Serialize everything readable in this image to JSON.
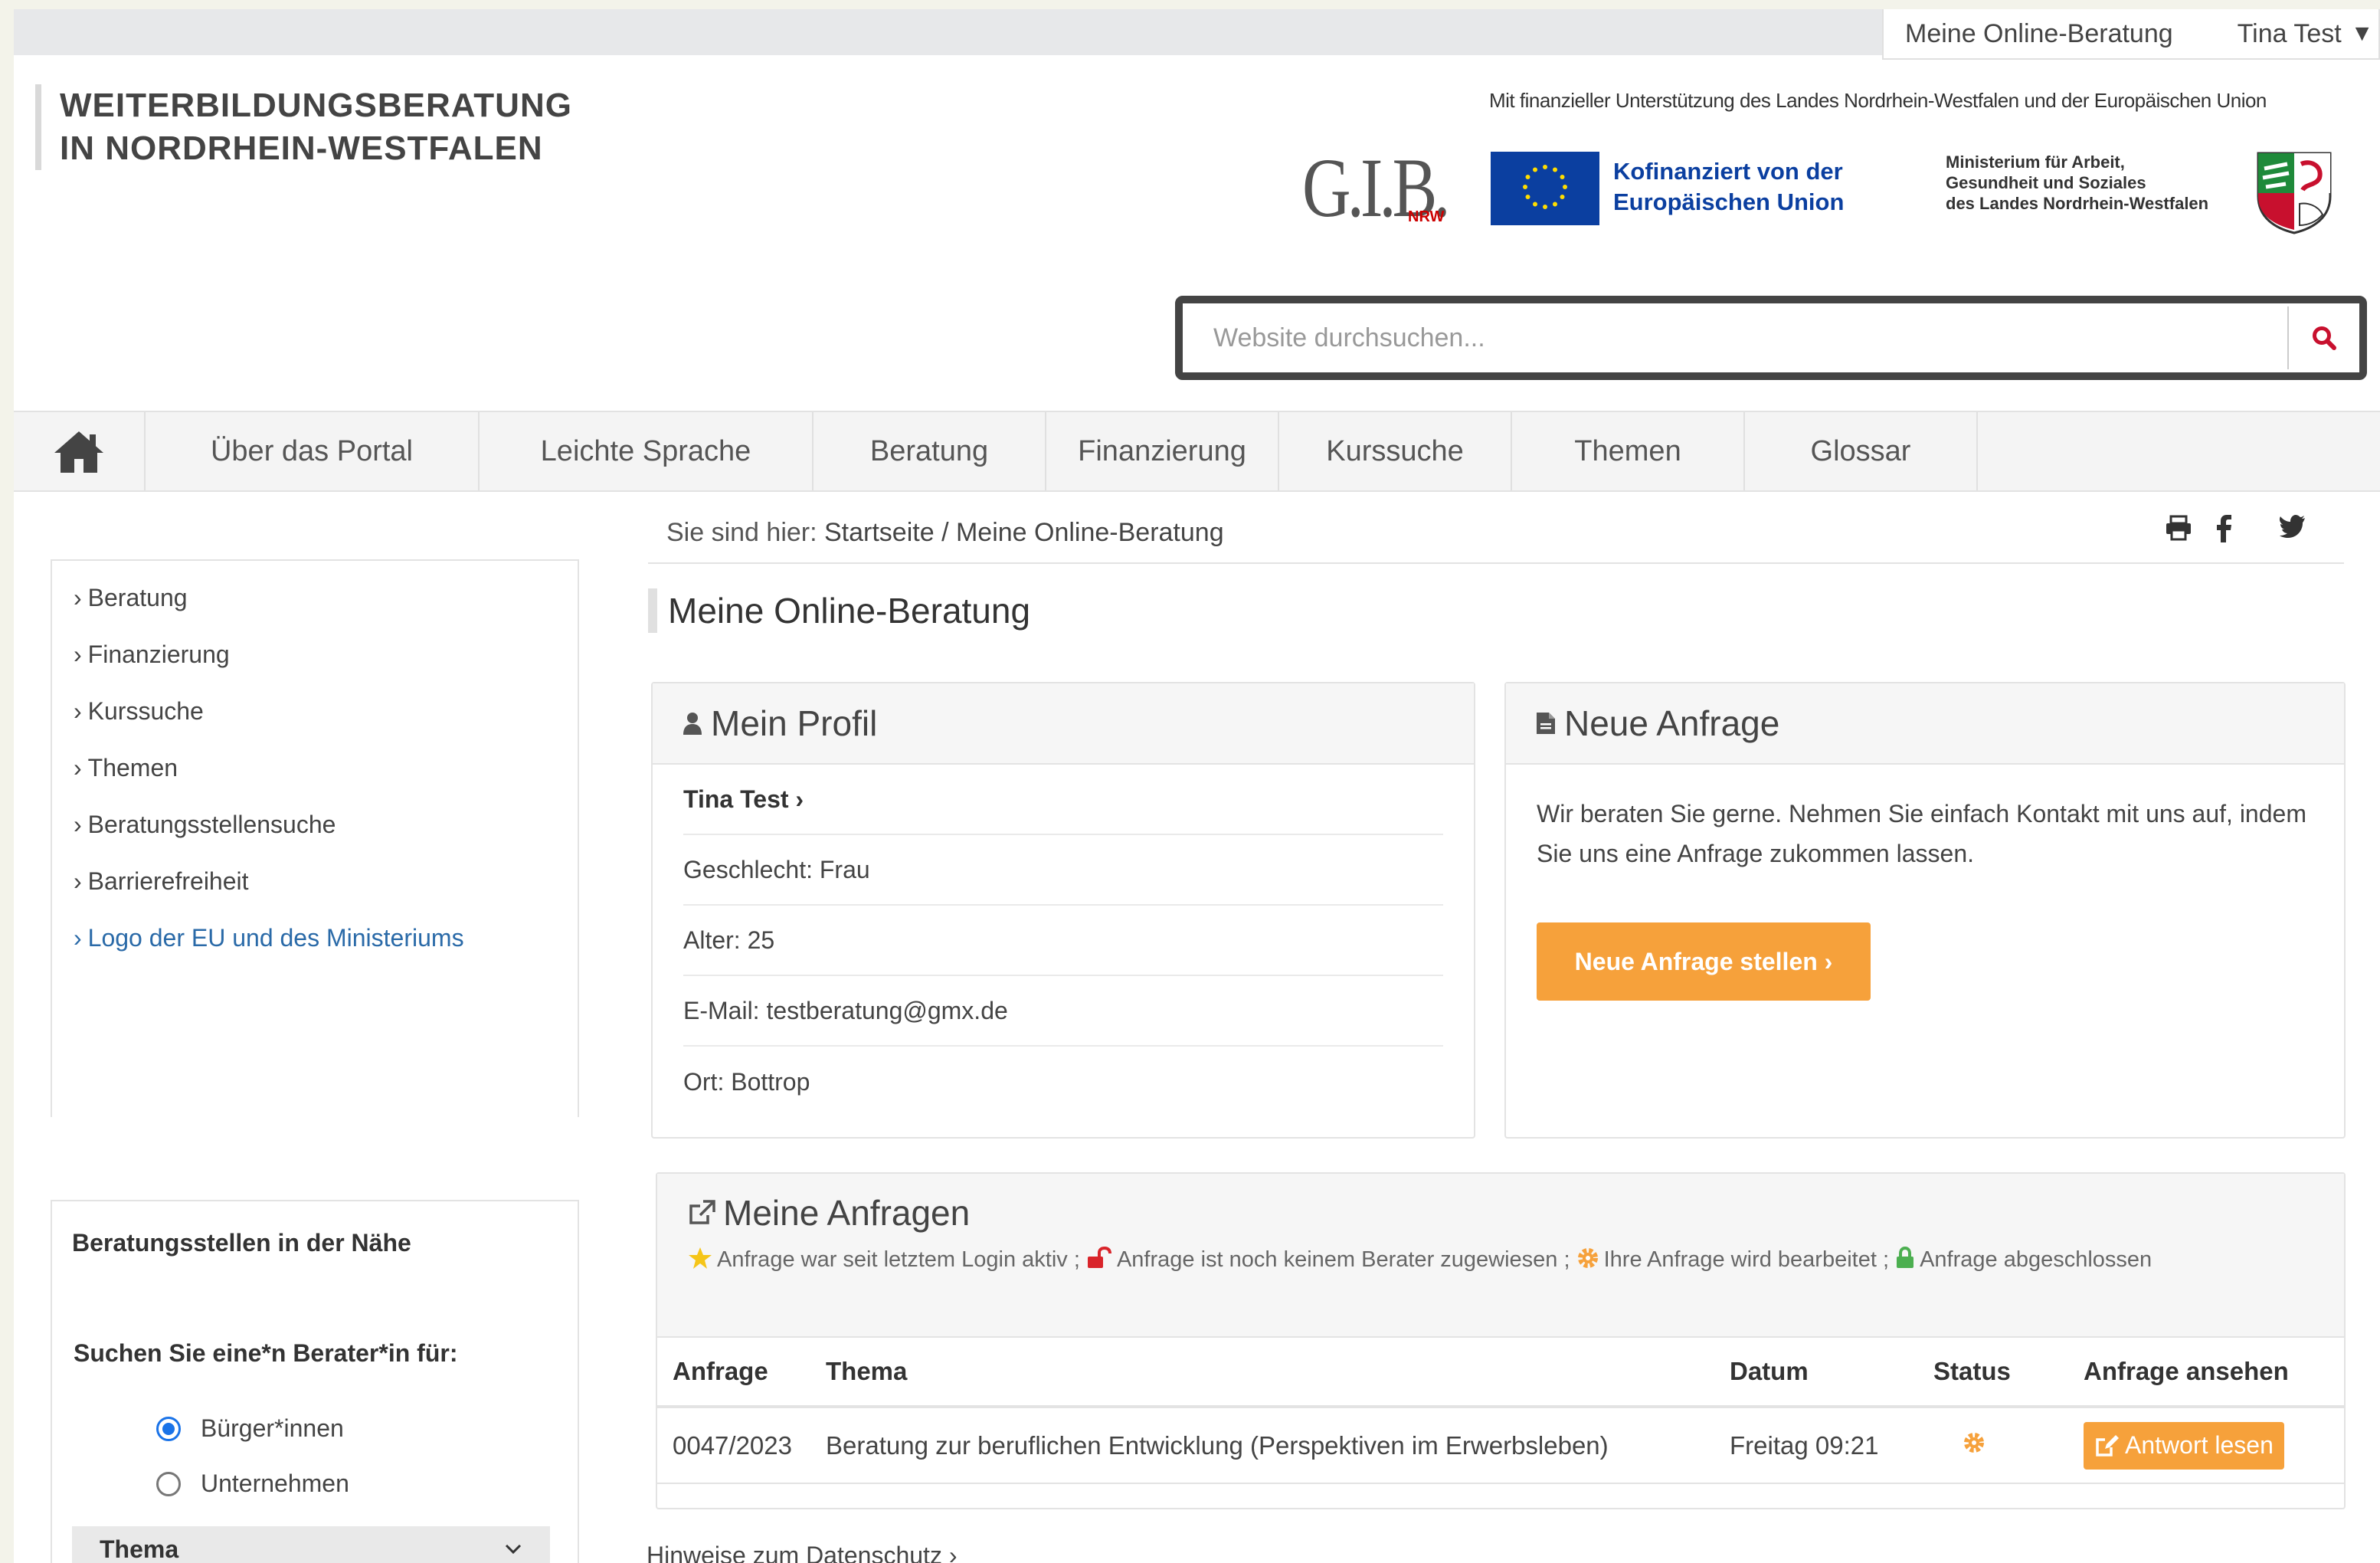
{
  "topbar": {
    "online_label": "Meine Online-Beratung",
    "user_label": "Tina Test",
    "caret": "▼"
  },
  "brand": {
    "line1": "WEITERBILDUNGSBERATUNG",
    "line2": "IN NORDRHEIN-WESTFALEN"
  },
  "sponsors": {
    "support_text": "Mit finanzieller Unterstützung des Landes Nordrhein-Westfalen und der Europäischen Union",
    "gib_logo": "G.I.B.",
    "gib_suffix": "NRW",
    "eu_line1": "Kofinanziert von der",
    "eu_line2": "Europäischen Union",
    "ministry_line1": "Ministerium für Arbeit,",
    "ministry_line2": "Gesundheit und Soziales",
    "ministry_line3": "des Landes Nordrhein-Westfalen"
  },
  "search": {
    "placeholder": "Website durchsuchen..."
  },
  "nav": {
    "items": [
      {
        "label": "Über das Portal"
      },
      {
        "label": "Leichte Sprache"
      },
      {
        "label": "Beratung"
      },
      {
        "label": "Finanzierung"
      },
      {
        "label": "Kurssuche"
      },
      {
        "label": "Themen"
      },
      {
        "label": "Glossar"
      }
    ]
  },
  "breadcrumb": {
    "prefix": "Sie sind hier:",
    "path": "Startseite / Meine Online-Beratung"
  },
  "sidebar": {
    "links": [
      {
        "label": "Beratung"
      },
      {
        "label": "Finanzierung"
      },
      {
        "label": "Kurssuche"
      },
      {
        "label": "Themen"
      },
      {
        "label": "Beratungsstellensuche"
      },
      {
        "label": "Barrierefreiheit"
      },
      {
        "label": "Logo der EU und des Ministeriums"
      }
    ],
    "nearby": {
      "title": "Beratungsstellen in der Nähe",
      "subtitle": "Suchen Sie eine*n Berater*in für:",
      "options": [
        {
          "label": "Bürger*innen",
          "selected": true
        },
        {
          "label": "Unternehmen",
          "selected": false
        }
      ],
      "select_label": "Thema"
    }
  },
  "page": {
    "title": "Meine Online-Beratung"
  },
  "profile": {
    "title": "Mein Profil",
    "name": "Tina Test ›",
    "gender": "Geschlecht: Frau",
    "age": "Alter: 25",
    "email": "E-Mail: testberatung@gmx.de",
    "city": "Ort: Bottrop"
  },
  "new_request": {
    "title": "Neue Anfrage",
    "text": "Wir beraten Sie gerne. Nehmen Sie einfach Kontakt mit uns auf, indem Sie uns eine Anfrage zukommen lassen.",
    "button": "Neue Anfrage stellen ›"
  },
  "requests": {
    "title": "Meine Anfragen",
    "legend": {
      "star": "Anfrage war seit letztem Login aktiv ;",
      "unlock": "Anfrage ist noch keinem Berater zugewiesen ;",
      "gear": "Ihre Anfrage wird bearbeitet ;",
      "lock": "Anfrage abgeschlossen"
    },
    "columns": {
      "id": "Anfrage",
      "topic": "Thema",
      "date": "Datum",
      "status": "Status",
      "view": "Anfrage ansehen"
    },
    "rows": [
      {
        "id": "0047/2023",
        "topic": "Beratung zur beruflichen Entwicklung (Perspektiven im Erwerbsleben)",
        "date": "Freitag 09:21",
        "status_icon": "gear-icon",
        "action": "Antwort lesen"
      }
    ]
  },
  "footer": {
    "privacy": "Hinweise zum Datenschutz ›"
  },
  "colors": {
    "accent": "#f6a13b",
    "eu_blue": "#0b3fa0",
    "link": "#2a6aa8",
    "radio": "#1a73e8"
  }
}
